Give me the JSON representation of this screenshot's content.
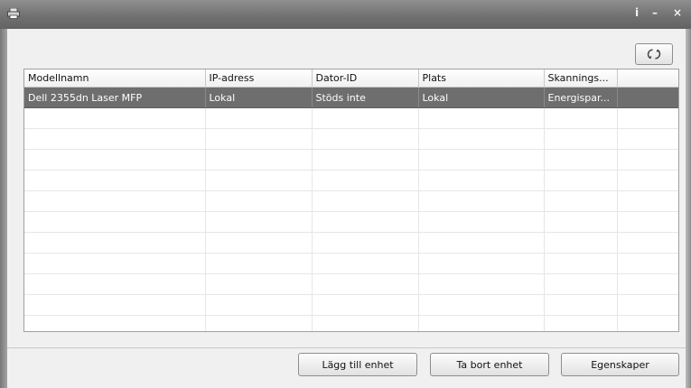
{
  "titlebar": {
    "icon": "printer-icon",
    "buttons": [
      {
        "icon": "info-icon",
        "glyph": "i"
      },
      {
        "icon": "minimize-icon",
        "glyph": "–"
      },
      {
        "icon": "close-icon",
        "glyph": "×"
      }
    ]
  },
  "toolbar": {
    "refresh_icon": "refresh-icon"
  },
  "table": {
    "columns": [
      "Modellnamn",
      "IP-adress",
      "Dator-ID",
      "Plats",
      "Skannings...",
      ""
    ],
    "rows": [
      [
        "Dell 2355dn Laser MFP",
        "Lokal",
        "Stöds inte",
        "Lokal",
        "Energispar...",
        ""
      ]
    ],
    "selected_row": 0
  },
  "buttons": {
    "add_device": "Lägg till enhet",
    "remove_device": "Ta bort enhet",
    "properties": "Egenskaper"
  },
  "colors": {
    "titlebar": "#6f6f6f",
    "selected_row": "#6e6e6e",
    "window_bg": "#f0f0f0"
  }
}
